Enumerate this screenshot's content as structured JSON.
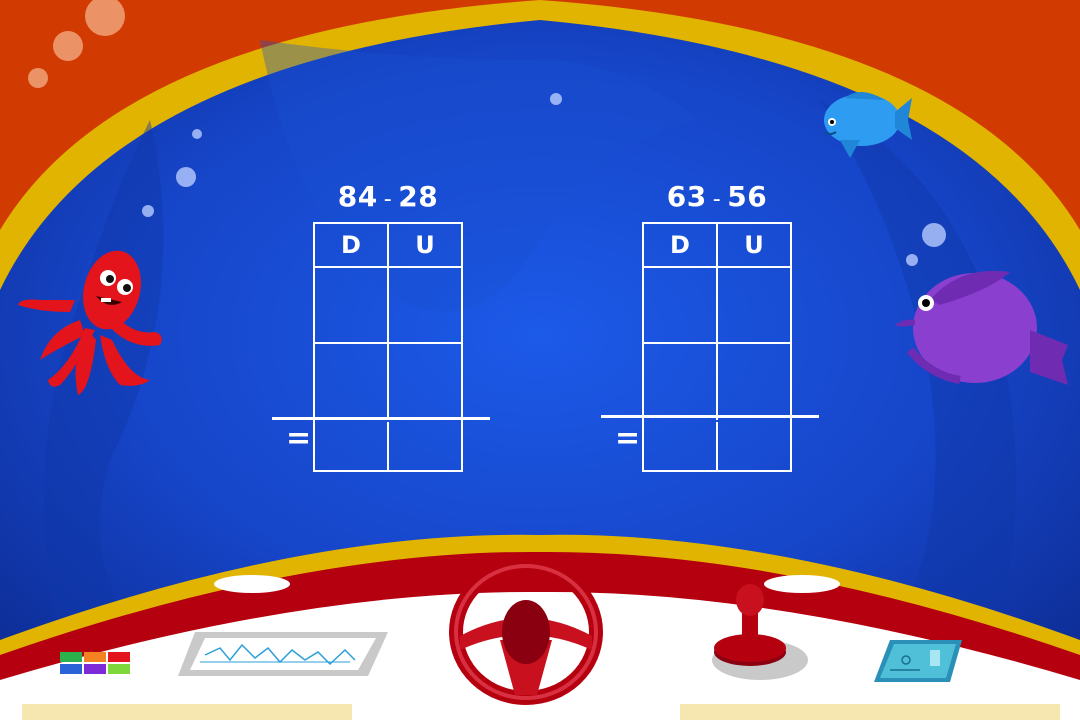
{
  "problems": [
    {
      "operand_a": "84",
      "operator": "-",
      "operand_b": "28",
      "column_headers": [
        "D",
        "U"
      ],
      "equals_sign": "="
    },
    {
      "operand_a": "63",
      "operator": "-",
      "operand_b": "56",
      "column_headers": [
        "D",
        "U"
      ],
      "equals_sign": "="
    }
  ],
  "colors": {
    "water": "#1a4fd8",
    "frame": "#e0b400",
    "frame_outer": "#d13a00",
    "dashboard": "#b50010",
    "octopus": "#e3141c",
    "blue_fish": "#2e9cf0",
    "purple_fish": "#8a3fcf"
  },
  "icons": [
    "octopus-character",
    "blue-fish",
    "purple-fish",
    "steering-wheel-icon",
    "joystick-icon",
    "monitor-graph-icon",
    "color-buttons-icon",
    "map-screen-icon"
  ]
}
